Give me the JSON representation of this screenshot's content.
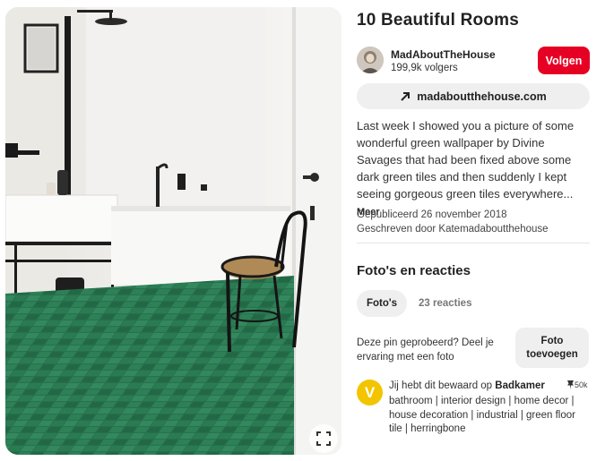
{
  "pin": {
    "title": "10 Beautiful Rooms",
    "image_alt_icon": "expand-icon"
  },
  "profile": {
    "name": "MadAboutTheHouse",
    "followers": "199,9k volgers",
    "follow_label": "Volgen"
  },
  "link": {
    "label": "madaboutthehouse.com",
    "icon": "arrow-up-right-icon"
  },
  "description": {
    "text": "Last week I showed you a picture of some wonderful green wallpaper by Divine Savages that had been fixed above some dark green tiles and then suddenly I kept seeing gorgeous green tiles everywhere...",
    "more_label": "Meer"
  },
  "meta": {
    "published": "Gepubliceerd 26 november 2018",
    "written_by": "Geschreven door Katemadaboutthehouse"
  },
  "reactions": {
    "section_title": "Foto's en reacties",
    "tab_photos": "Foto's",
    "tab_comments": "23 reacties",
    "try_prompt": "Deze pin geprobeerd? Deel je ervaring met een foto",
    "add_photo_line1": "Foto",
    "add_photo_line2": "toevoegen"
  },
  "saved": {
    "avatar_letter": "V",
    "prefix": "Jij hebt dit bewaard op ",
    "board": "Badkamer",
    "count": "50k",
    "tags": "bathroom | interior design | home decor | house decoration | industrial | green floor tile | herringbone"
  },
  "colors": {
    "brand_red": "#e60023",
    "board_avatar": "#f2c500",
    "tile_green": "#1f6b45"
  }
}
